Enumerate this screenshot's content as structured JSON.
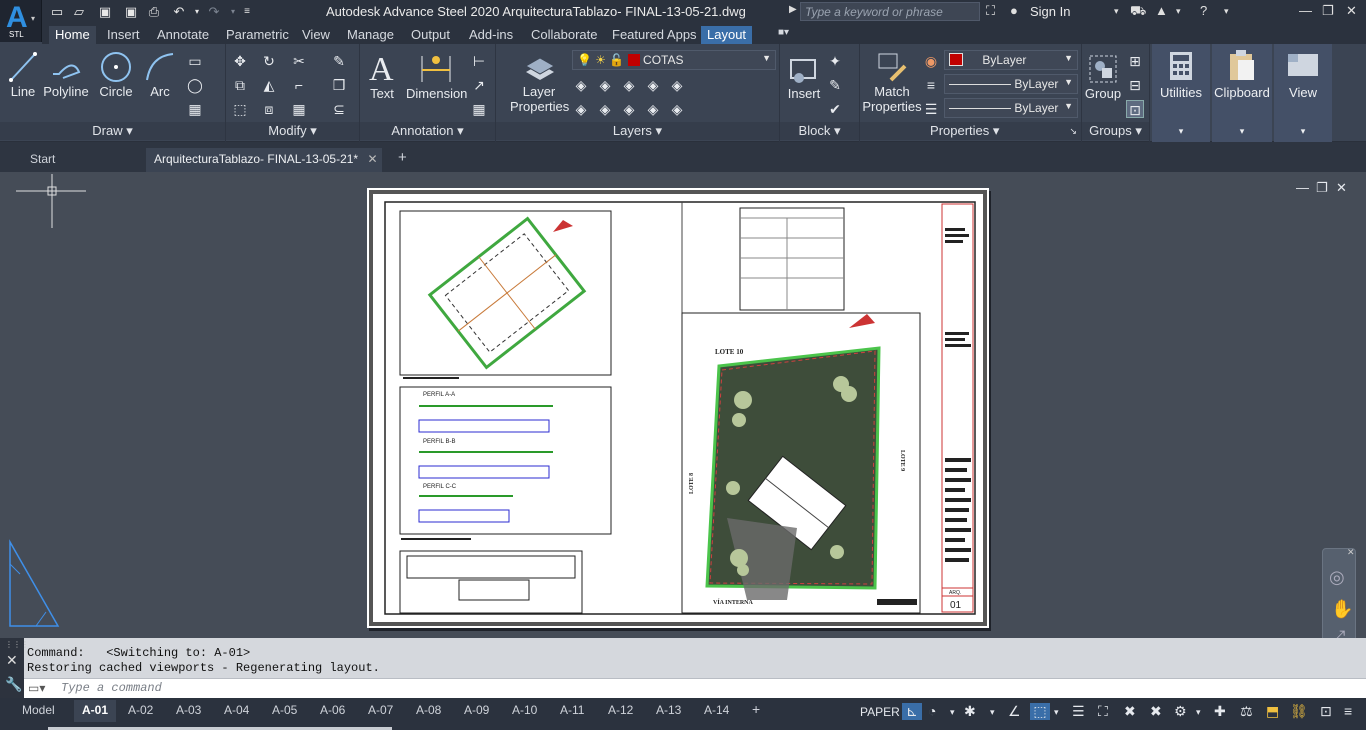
{
  "app": {
    "logo_letter": "A",
    "logo_sub": "STL",
    "title": "Autodesk Advance Steel 2020    ArquitecturaTablazo- FINAL-13-05-21.dwg",
    "search_placeholder": "Type a keyword or phrase",
    "sign_in": "Sign In"
  },
  "ribbon_tabs": [
    "Home",
    "Insert",
    "Annotate",
    "Parametric",
    "View",
    "Manage",
    "Output",
    "Add-ins",
    "Collaborate",
    "Featured Apps",
    "Layout"
  ],
  "panels": {
    "draw": {
      "title": "Draw",
      "line": "Line",
      "polyline": "Polyline",
      "circle": "Circle",
      "arc": "Arc"
    },
    "modify": {
      "title": "Modify"
    },
    "annotation": {
      "title": "Annotation",
      "text": "Text",
      "dimension": "Dimension"
    },
    "layers": {
      "title": "Layers",
      "layer_properties_1": "Layer",
      "layer_properties_2": "Properties",
      "current_layer": "COTAS"
    },
    "block": {
      "title": "Block",
      "insert": "Insert"
    },
    "properties": {
      "title": "Properties",
      "match_1": "Match",
      "match_2": "Properties",
      "color": "ByLayer",
      "linetype": "ByLayer",
      "lineweight": "ByLayer"
    },
    "groups": {
      "title": "Groups",
      "group": "Group"
    },
    "utilities": "Utilities",
    "clipboard": "Clipboard",
    "view": "View"
  },
  "doc_tabs": {
    "start": "Start",
    "active": "ArquitecturaTablazo- FINAL-13-05-21*"
  },
  "sheet": {
    "perfil_a": "PERFIL A-A",
    "perfil_b": "PERFIL B-B",
    "perfil_c": "PERFIL C-C",
    "lote_top": "LOTE 10",
    "lote_left": "LOTE 8",
    "lote_right": "LOTE 9",
    "via": "VÍA INTERNA",
    "sheet_no": "01",
    "sheet_label": "ARQ."
  },
  "command": {
    "line1": "Command:   <Switching to: A-01>",
    "line2": "Restoring cached viewports - Regenerating layout.",
    "placeholder": "Type a command"
  },
  "layout_tabs": [
    "Model",
    "A-01",
    "A-02",
    "A-03",
    "A-04",
    "A-05",
    "A-06",
    "A-07",
    "A-08",
    "A-09",
    "A-10",
    "A-11",
    "A-12",
    "A-13",
    "A-14"
  ],
  "status": {
    "space": "PAPER"
  },
  "colors": {
    "accent": "#3a6ea8",
    "layer_color": "#c00000",
    "color_swatch": "#c00000"
  }
}
